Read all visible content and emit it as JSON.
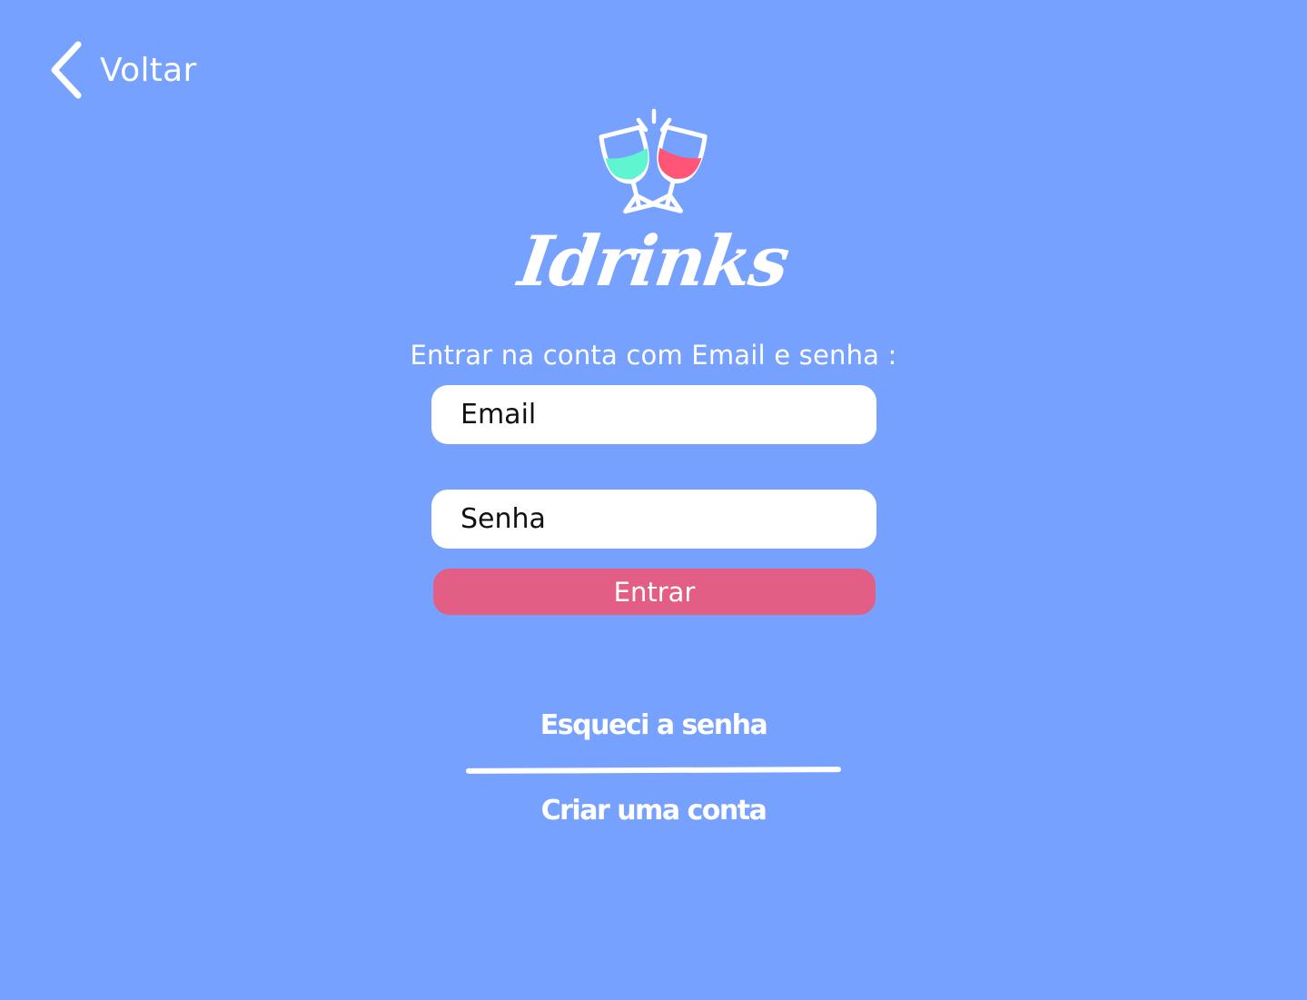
{
  "nav": {
    "back_label": "Voltar",
    "back_icon": "chevron-left-icon"
  },
  "logo": {
    "wordmark": "Idrinks",
    "icon": "toasting-glasses-icon",
    "left_wine_color": "#5ef5d0",
    "right_wine_color": "#ff5577"
  },
  "form": {
    "instruction": "Entrar na conta com Email e senha :",
    "email_placeholder": "Email",
    "password_placeholder": "Senha",
    "submit_label": "Entrar"
  },
  "links": {
    "forgot_password": "Esqueci a senha",
    "create_account": "Criar uma conta"
  },
  "colors": {
    "background": "#77a1ff",
    "button": "#e35e85",
    "text": "#ffffff"
  }
}
